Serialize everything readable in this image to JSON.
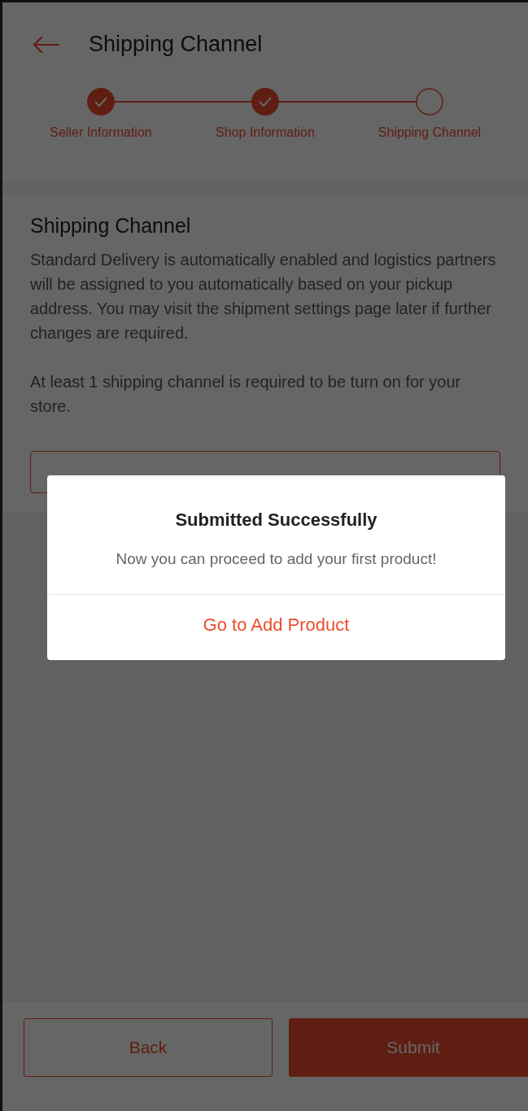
{
  "header": {
    "title": "Shipping Channel"
  },
  "steps": [
    {
      "label": "Seller Information",
      "completed": true
    },
    {
      "label": "Shop Information",
      "completed": true
    },
    {
      "label": "Shipping Channel",
      "completed": false
    }
  ],
  "section": {
    "title": "Shipping Channel",
    "paragraphs": [
      "Standard Delivery is automatically enabled and logistics partners will be assigned to you automatically based on your pickup address. You may visit the shipment settings page later if further changes are required.",
      "At least 1 shipping channel is required to be turn on for your store."
    ]
  },
  "dialog": {
    "title": "Submitted Successfully",
    "message": "Now you can proceed to add your first product!",
    "action": "Go to Add Product"
  },
  "footer": {
    "buttons": [
      {
        "label": "Back",
        "kind": "outline"
      },
      {
        "label": "Submit",
        "kind": "primary"
      }
    ]
  }
}
